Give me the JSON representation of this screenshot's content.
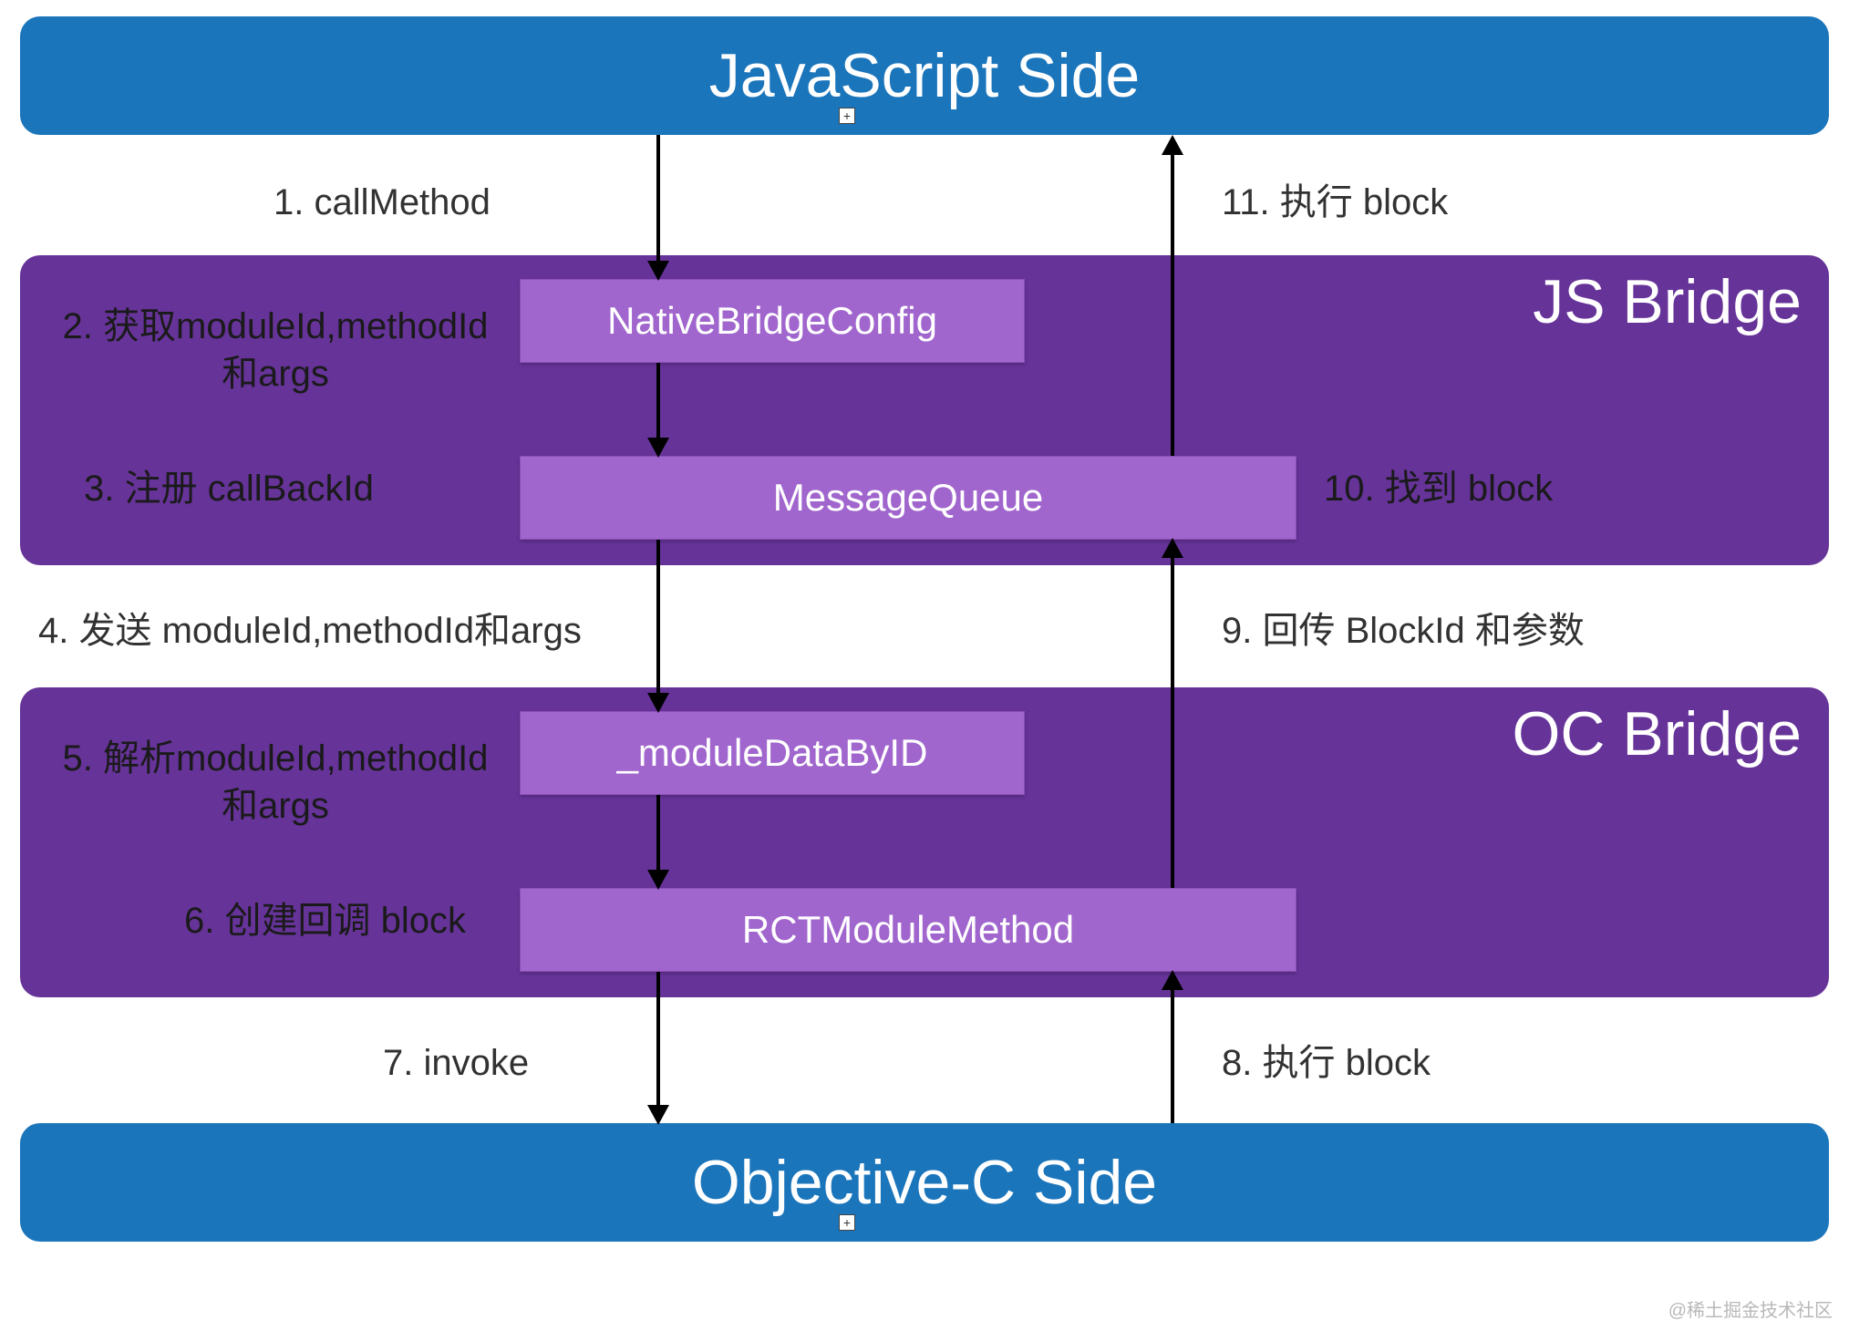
{
  "bands": {
    "top": "JavaScript Side",
    "bottom": "Objective-C Side",
    "jsBridge": "JS Bridge",
    "ocBridge": "OC Bridge"
  },
  "boxes": {
    "nativeBridgeConfig": "NativeBridgeConfig",
    "messageQueue": "MessageQueue",
    "moduleDataById": "_moduleDataByID",
    "rctModuleMethod": "RCTModuleMethod"
  },
  "steps": {
    "s1": "1. callMethod",
    "s2a": "2. 获取moduleId,methodId",
    "s2b": "和args",
    "s3": "3. 注册 callBackId",
    "s4": "4. 发送 moduleId,methodId和args",
    "s5a": "5. 解析moduleId,methodId",
    "s5b": "和args",
    "s6": "6. 创建回调 block",
    "s7": "7. invoke",
    "s8": "8. 执行 block",
    "s9": "9. 回传 BlockId 和参数",
    "s10": "10. 找到 block",
    "s11": "11. 执行 block"
  },
  "watermark": "@稀土掘金技术社区",
  "colors": {
    "blue": "#1b75bb",
    "purpleDark": "#663399",
    "purpleLight": "#a066cd"
  }
}
